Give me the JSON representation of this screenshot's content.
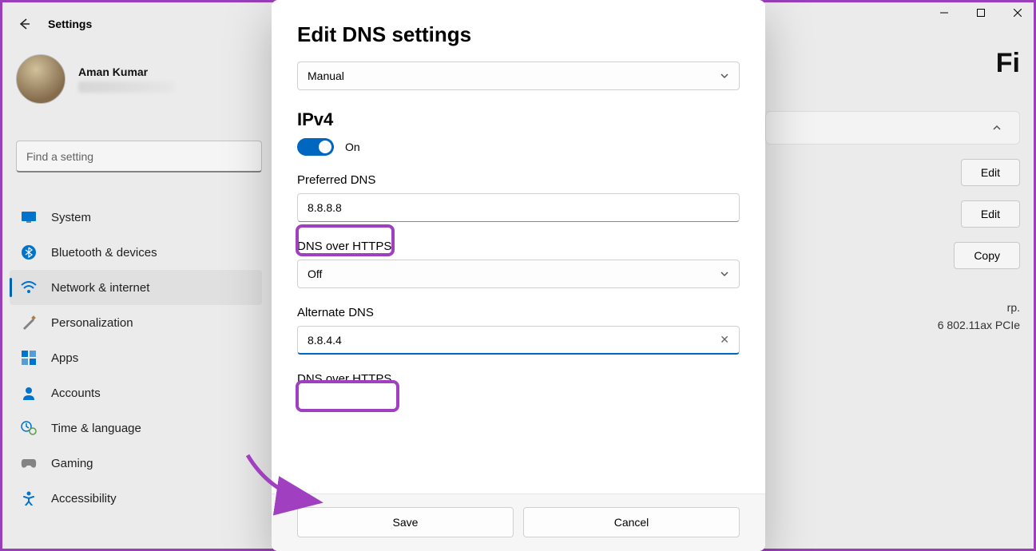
{
  "header": {
    "app_title": "Settings"
  },
  "user": {
    "name": "Aman Kumar"
  },
  "search": {
    "placeholder": "Find a setting"
  },
  "sidebar": {
    "items": [
      {
        "label": "System"
      },
      {
        "label": "Bluetooth & devices"
      },
      {
        "label": "Network & internet"
      },
      {
        "label": "Personalization"
      },
      {
        "label": "Apps"
      },
      {
        "label": "Accounts"
      },
      {
        "label": "Time & language"
      },
      {
        "label": "Gaming"
      },
      {
        "label": "Accessibility"
      }
    ]
  },
  "background": {
    "title_suffix": "Fi",
    "edit": "Edit",
    "copy": "Copy",
    "line1": "rp.",
    "line2": "6 802.11ax PCIe"
  },
  "dialog": {
    "title": "Edit DNS settings",
    "mode": "Manual",
    "ipv4": {
      "heading": "IPv4",
      "toggle_label": "On",
      "preferred_label": "Preferred DNS",
      "preferred_value": "8.8.8.8",
      "doh_label": "DNS over HTTPS",
      "doh_value": "Off",
      "alternate_label": "Alternate DNS",
      "alternate_value": "8.8.4.4",
      "doh2_label": "DNS over HTTPS"
    },
    "save": "Save",
    "cancel": "Cancel"
  }
}
